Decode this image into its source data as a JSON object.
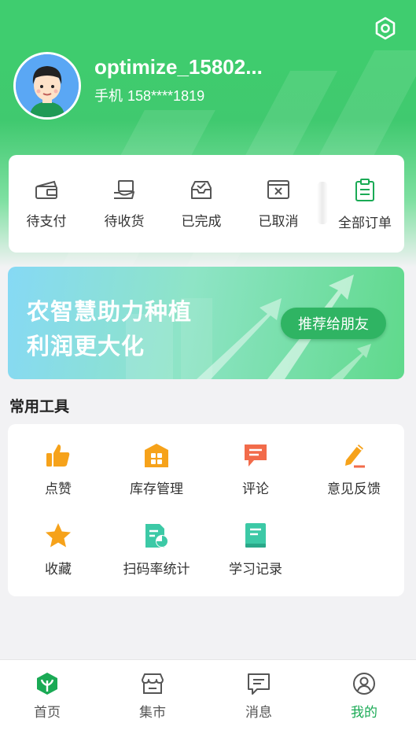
{
  "profile": {
    "username": "optimize_15802...",
    "phone_label": "手机",
    "phone_number": "158****1819"
  },
  "icons": {
    "settings": "gear-icon"
  },
  "orders": [
    {
      "label": "待支付",
      "icon": "wallet-icon"
    },
    {
      "label": "待收货",
      "icon": "hand-package-icon"
    },
    {
      "label": "已完成",
      "icon": "inbox-check-icon"
    },
    {
      "label": "已取消",
      "icon": "cancel-box-icon"
    },
    {
      "label": "全部订单",
      "icon": "clipboard-icon"
    }
  ],
  "banner": {
    "line1": "农智慧助力种植",
    "line2": "利润更大化",
    "button": "推荐给朋友"
  },
  "tools_section": {
    "title": "常用工具",
    "items": [
      {
        "label": "点赞",
        "icon": "thumbs-up-icon",
        "color": "#f6a21a"
      },
      {
        "label": "库存管理",
        "icon": "warehouse-icon",
        "color": "#f6a21a"
      },
      {
        "label": "评论",
        "icon": "comment-icon",
        "color": "#f26b4a"
      },
      {
        "label": "意见反馈",
        "icon": "pencil-icon",
        "color": "#f6a21a"
      },
      {
        "label": "收藏",
        "icon": "star-icon",
        "color": "#f6a21a"
      },
      {
        "label": "扫码率统计",
        "icon": "stats-doc-icon",
        "color": "#3cc9a6"
      },
      {
        "label": "学习记录",
        "icon": "book-icon",
        "color": "#3cc9a6"
      }
    ]
  },
  "tabbar": {
    "items": [
      {
        "label": "首页",
        "icon": "home-plant-icon"
      },
      {
        "label": "集市",
        "icon": "market-icon"
      },
      {
        "label": "消息",
        "icon": "message-icon"
      },
      {
        "label": "我的",
        "icon": "user-icon"
      }
    ],
    "active": "我的"
  },
  "colors": {
    "brand_green": "#3fcd6f",
    "active_tab": "#1aaa55",
    "accent_orange": "#f6a21a"
  }
}
